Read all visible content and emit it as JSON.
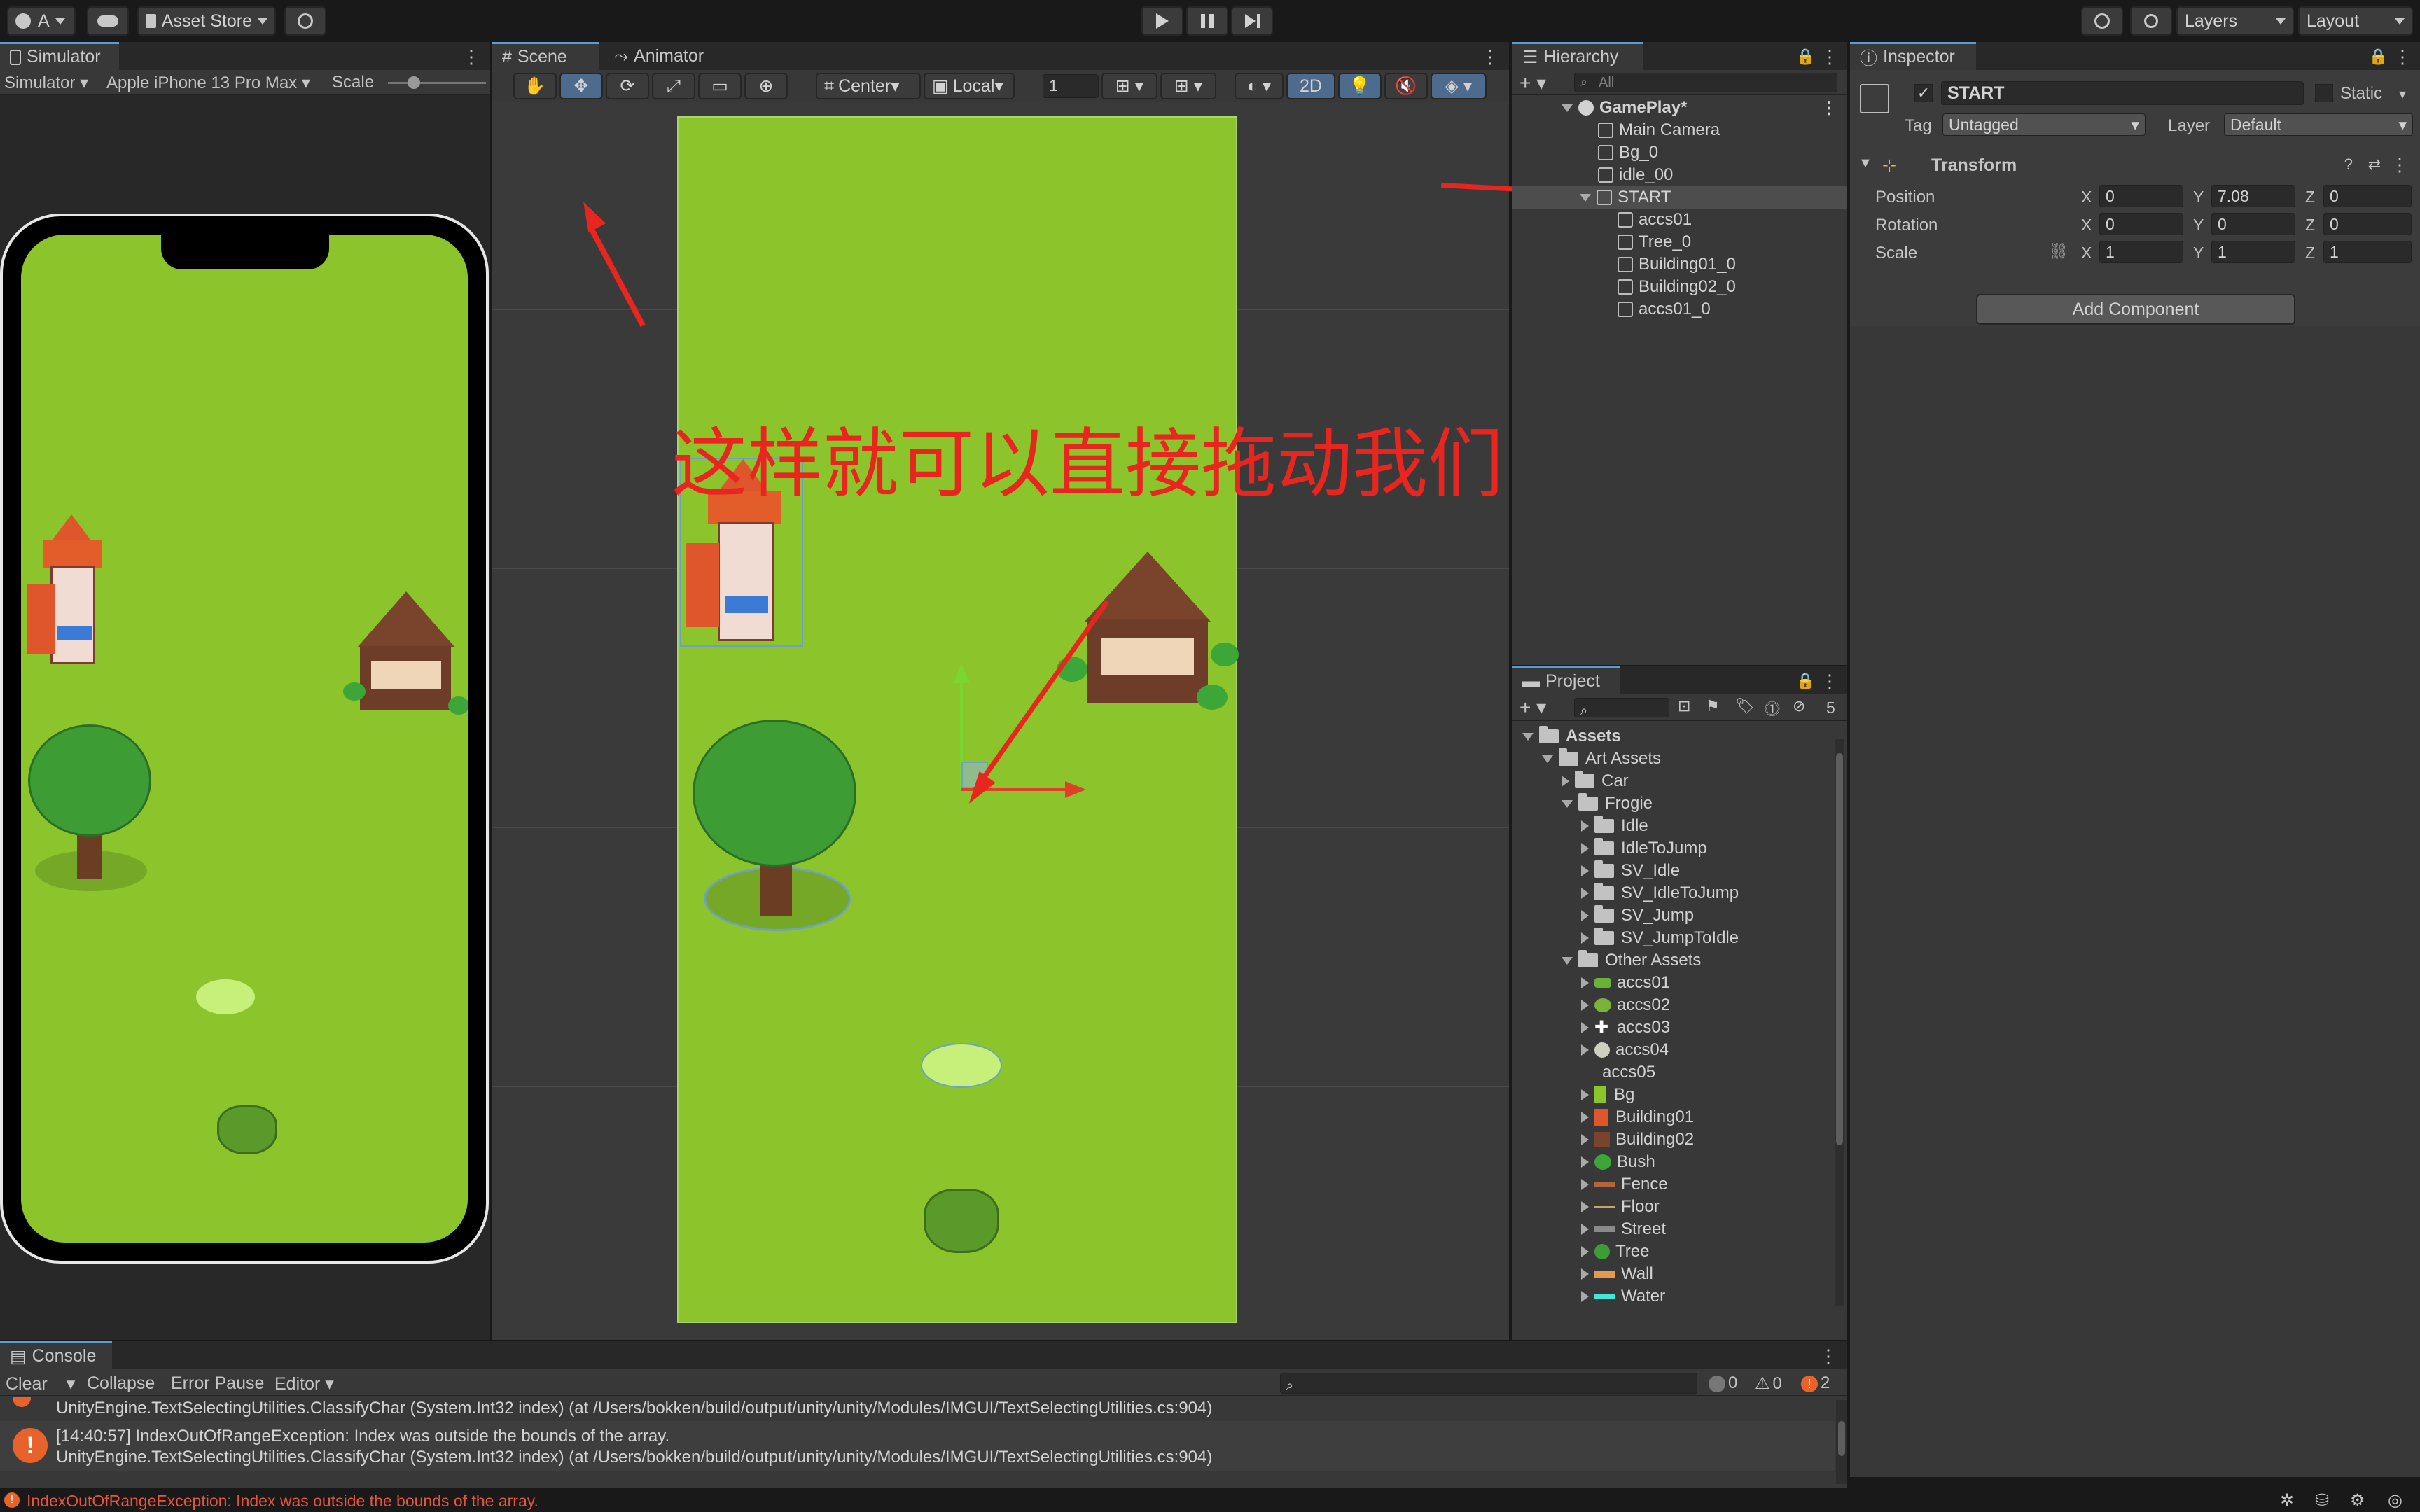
{
  "toolbar": {
    "account": "A",
    "asset_store": "Asset Store",
    "layers": "Layers",
    "layout": "Layout"
  },
  "simulator": {
    "tab": "Simulator",
    "mode": "Simulator",
    "device": "Apple iPhone 13 Pro Max",
    "scale_label": "Scale"
  },
  "scene": {
    "tabs": [
      "Scene",
      "Animator"
    ],
    "pivot": "Center",
    "space": "Local",
    "grid_value": "1",
    "mode_2d": "2D",
    "annotation_text": "这样就可以直接拖动我们的 START 了"
  },
  "hierarchy": {
    "tab": "Hierarchy",
    "search_placeholder": "All",
    "root": "GamePlay*",
    "items": [
      "Main Camera",
      "Bg_0",
      "idle_00",
      "START"
    ],
    "children": [
      "accs01",
      "Tree_0",
      "Building01_0",
      "Building02_0",
      "accs01_0"
    ]
  },
  "inspector": {
    "tab": "Inspector",
    "object_name": "START",
    "static_label": "Static",
    "tag_label": "Tag",
    "tag_value": "Untagged",
    "layer_label": "Layer",
    "layer_value": "Default",
    "component": "Transform",
    "position": {
      "label": "Position",
      "x": "0",
      "y": "7.08",
      "z": "0"
    },
    "rotation": {
      "label": "Rotation",
      "x": "0",
      "y": "0",
      "z": "0"
    },
    "scale": {
      "label": "Scale",
      "x": "1",
      "y": "1",
      "z": "1"
    },
    "add_component": "Add Component"
  },
  "project": {
    "tab": "Project",
    "hidden_count": "5",
    "assets_root": "Assets",
    "art_assets": "Art Assets",
    "art_children": [
      "Car",
      "Frogie"
    ],
    "frogie_children": [
      "Idle",
      "IdleToJump",
      "SV_Idle",
      "SV_IdleToJump",
      "SV_Jump",
      "SV_JumpToIdle"
    ],
    "other_assets": "Other Assets",
    "other_children": [
      "accs01",
      "accs02",
      "accs03",
      "accs04",
      "accs05",
      "Bg",
      "Building01",
      "Building02",
      "Bush",
      "Fence",
      "Floor",
      "Street",
      "Tree",
      "Wall",
      "Water"
    ]
  },
  "console": {
    "tab": "Console",
    "buttons": [
      "Clear",
      "Collapse",
      "Error Pause",
      "Editor"
    ],
    "counts": {
      "info": "0",
      "warn": "0",
      "error": "2"
    },
    "line1": "UnityEngine.TextSelectingUtilities.ClassifyChar (System.Int32 index) (at /Users/bokken/build/output/unity/unity/Modules/IMGUI/TextSelectingUtilities.cs:904)",
    "line2a": "[14:40:57] IndexOutOfRangeException: Index was outside the bounds of the array.",
    "line2b": "UnityEngine.TextSelectingUtilities.ClassifyChar (System.Int32 index) (at /Users/bokken/build/output/unity/unity/Modules/IMGUI/TextSelectingUtilities.cs:904)",
    "status": "IndexOutOfRangeException: Index was outside the bounds of the array."
  },
  "colors": {
    "grass": "#8bc42b",
    "annotation": "#e8261f",
    "accent": "#5b9bd6"
  }
}
